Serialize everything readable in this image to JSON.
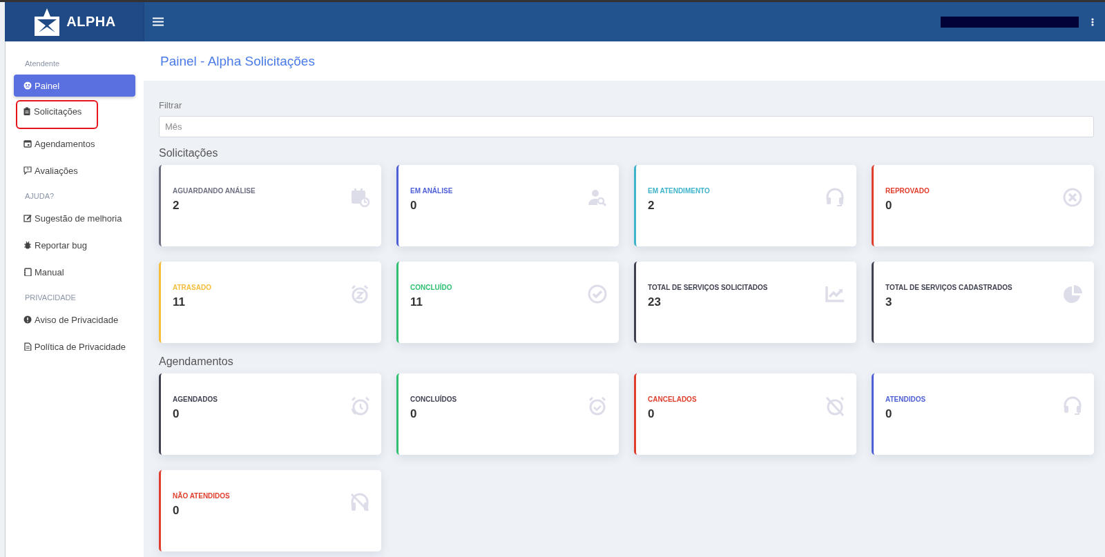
{
  "header": {
    "logo": "ALPHA"
  },
  "sidebar": {
    "sections": [
      {
        "title": "Atendente",
        "items": [
          {
            "label": "Painel",
            "selected": true,
            "highlighted": false
          },
          {
            "label": "Solicitações",
            "selected": false,
            "highlighted": true
          },
          {
            "label": "Agendamentos",
            "selected": false,
            "highlighted": false
          },
          {
            "label": "Avaliações",
            "selected": false,
            "highlighted": false
          }
        ]
      },
      {
        "title": "AJUDA?",
        "items": [
          {
            "label": "Sugestão de melhoria",
            "selected": false,
            "highlighted": false
          },
          {
            "label": "Reportar bug",
            "selected": false,
            "highlighted": false
          },
          {
            "label": "Manual",
            "selected": false,
            "highlighted": false
          }
        ]
      },
      {
        "title": "PRIVACIDADE",
        "items": [
          {
            "label": "Aviso de Privacidade",
            "selected": false,
            "highlighted": false
          },
          {
            "label": "Política de Privacidade",
            "selected": false,
            "highlighted": false
          }
        ]
      }
    ]
  },
  "page_title": "Painel - Alpha Solicitações",
  "filter": {
    "label": "Filtrar",
    "placeholder": "Mês"
  },
  "groups": [
    {
      "title": "Solicitações",
      "cards": [
        {
          "label": "AGUARDANDO ANÁLISE",
          "value": "2",
          "color": "#6c6f80"
        },
        {
          "label": "EM ANÁLISE",
          "value": "0",
          "color": "#4e5fd6"
        },
        {
          "label": "EM ATENDIMENTO",
          "value": "2",
          "color": "#3fb3c9"
        },
        {
          "label": "REPROVADO",
          "value": "0",
          "color": "#e03e2d"
        },
        {
          "label": "ATRASADO",
          "value": "11",
          "color": "#f5bd3a"
        },
        {
          "label": "CONCLUÍDO",
          "value": "11",
          "color": "#2fbf71"
        },
        {
          "label": "TOTAL DE SERVIÇOS SOLICITADOS",
          "value": "23",
          "color": "#3f4150"
        },
        {
          "label": "TOTAL DE SERVIÇOS CADASTRADOS",
          "value": "3",
          "color": "#3f4150"
        }
      ]
    },
    {
      "title": "Agendamentos",
      "cards": [
        {
          "label": "AGENDADOS",
          "value": "0",
          "color": "#3f4150"
        },
        {
          "label": "CONCLUÍDOS",
          "value": "0",
          "color": "#2fbf71",
          "label_tinted": false
        },
        {
          "label": "CANCELADOS",
          "value": "0",
          "color": "#e03e2d"
        },
        {
          "label": "ATENDIDOS",
          "value": "0",
          "color": "#4e5fd6"
        },
        {
          "label": "NÃO ATENDIDOS",
          "value": "0",
          "color": "#e03e2d"
        }
      ]
    }
  ]
}
